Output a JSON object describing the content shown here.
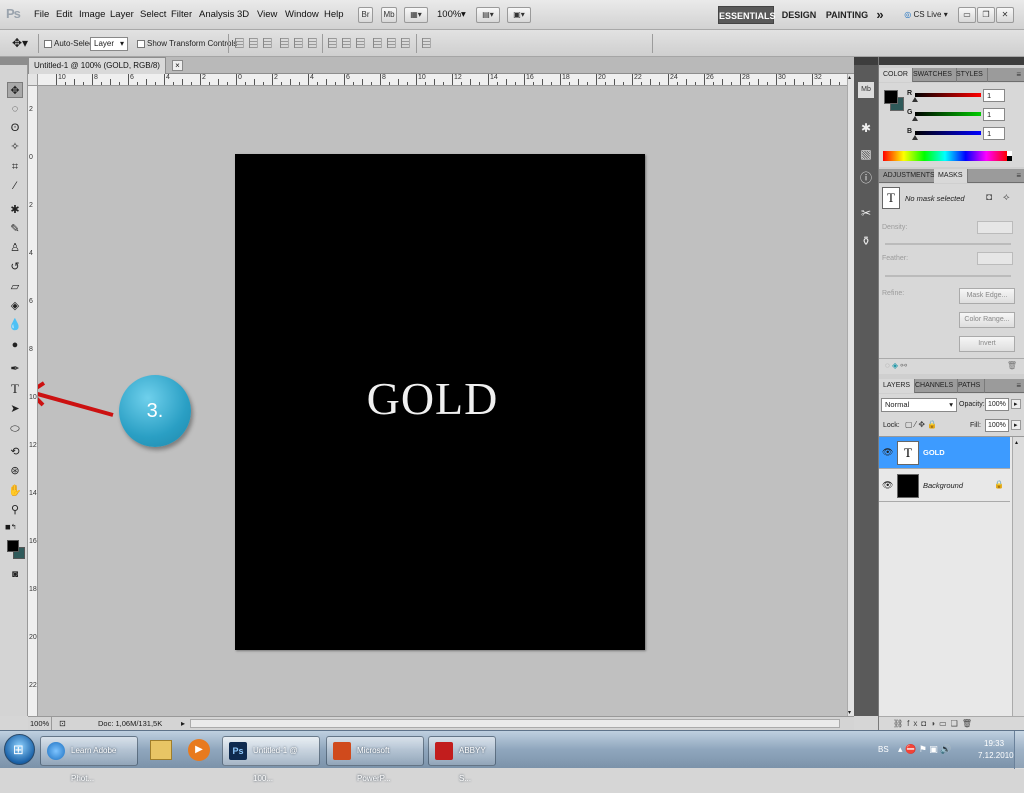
{
  "app": {
    "logo": "Ps"
  },
  "menu": [
    "File",
    "Edit",
    "Image",
    "Layer",
    "Select",
    "Filter",
    "Analysis",
    "3D",
    "View",
    "Window",
    "Help"
  ],
  "appbar": {
    "br": "Br",
    "mb": "Mb",
    "zoom": "100%",
    "zoom_arrow": "▾"
  },
  "workspaces": {
    "essentials": "ESSENTIALS",
    "design": "DESIGN",
    "painting": "PAINTING",
    "more": "»",
    "cslive": "CS Live ▾"
  },
  "options": {
    "auto_select": "Auto-Select:",
    "auto_select_value": "Layer",
    "show_transform": "Show Transform Controls"
  },
  "document_tab": {
    "title": "Untitled-1 @ 100% (GOLD, RGB/8) *",
    "close": "×"
  },
  "canvas": {
    "text": "GOLD"
  },
  "ruler": {
    "h": [
      "10",
      "8",
      "6",
      "4",
      "2",
      "0",
      "2",
      "4",
      "6",
      "8",
      "10",
      "12",
      "14",
      "16",
      "18",
      "20",
      "22",
      "24",
      "26",
      "28",
      "30",
      "32"
    ],
    "v": [
      "2",
      "0",
      "2",
      "4",
      "6",
      "8",
      "10",
      "12",
      "14",
      "16",
      "18",
      "20",
      "22",
      "24"
    ]
  },
  "status": {
    "zoom": "100%",
    "doc": "Doc: 1,06M/131,5K"
  },
  "color_panel": {
    "tabs": [
      "COLOR",
      "SWATCHES",
      "STYLES"
    ],
    "r_label": "R",
    "g_label": "G",
    "b_label": "B",
    "r": "1",
    "g": "1",
    "b": "1"
  },
  "masks_panel": {
    "tabs": [
      "ADJUSTMENTS",
      "MASKS"
    ],
    "status": "No mask selected",
    "density": "Density:",
    "feather": "Feather:",
    "refine": "Refine:",
    "mask_edge": "Mask Edge...",
    "color_range": "Color Range...",
    "invert": "Invert"
  },
  "layers_panel": {
    "tabs": [
      "LAYERS",
      "CHANNELS",
      "PATHS"
    ],
    "blend": "Normal",
    "opacity_label": "Opacity:",
    "opacity": "100%",
    "lock_label": "Lock:",
    "fill_label": "Fill:",
    "fill": "100%",
    "layers": [
      {
        "name": "GOLD"
      },
      {
        "name": "Background"
      }
    ]
  },
  "annotation": {
    "label": "3."
  },
  "taskbar": {
    "items": [
      "Learn Adobe Phot...",
      "Untitled-1 @ 100...",
      "Microsoft PowerP...",
      "ABBYY S..."
    ],
    "lang": "BS",
    "time": "19:33",
    "date": "7.12.2010"
  },
  "colors": {
    "highlight": "#3d9bff",
    "annotation_circle": "#3aaed1",
    "arrow": "#cc1111"
  }
}
